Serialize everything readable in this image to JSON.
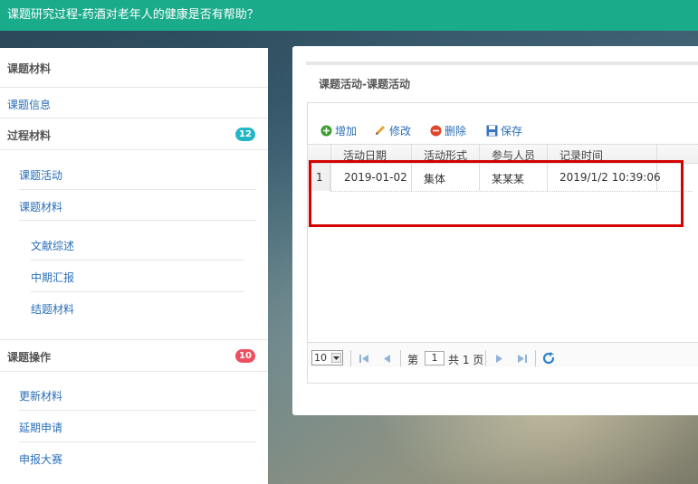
{
  "header": {
    "title": "课题研究过程-药酒对老年人的健康是否有帮助？"
  },
  "sidebar": {
    "section1": {
      "title": "课题材料"
    },
    "item_info": "课题信息",
    "section2": {
      "title": "过程材料",
      "badge": "12"
    },
    "sub_items": [
      "课题活动",
      "课题材料"
    ],
    "sub_sub_items": [
      "文献综述",
      "中期汇报",
      "结题材料"
    ],
    "section3": {
      "title": "课题操作",
      "badge": "10"
    },
    "op_items": [
      "更新材料",
      "延期申请",
      "申报大赛"
    ]
  },
  "panel": {
    "title": "课题活动-课题活动",
    "toolbar": {
      "add": "增加",
      "edit": "修改",
      "delete": "删除",
      "save": "保存"
    },
    "columns": [
      "活动日期",
      "活动形式",
      "参与人员",
      "记录时间"
    ],
    "rows": [
      {
        "num": "1",
        "date": "2019-01-02",
        "form": "集体",
        "people": "某某某",
        "time": "2019/1/2 10:39:06"
      }
    ],
    "pager": {
      "page_size": "10",
      "page_prefix": "第",
      "page_value": "1",
      "page_suffix": "共 1 页"
    }
  },
  "colors": {
    "topbar": "#1aab8a",
    "badge_teal": "#23b7c6",
    "badge_red": "#ec5061",
    "highlight": "#d40000"
  }
}
